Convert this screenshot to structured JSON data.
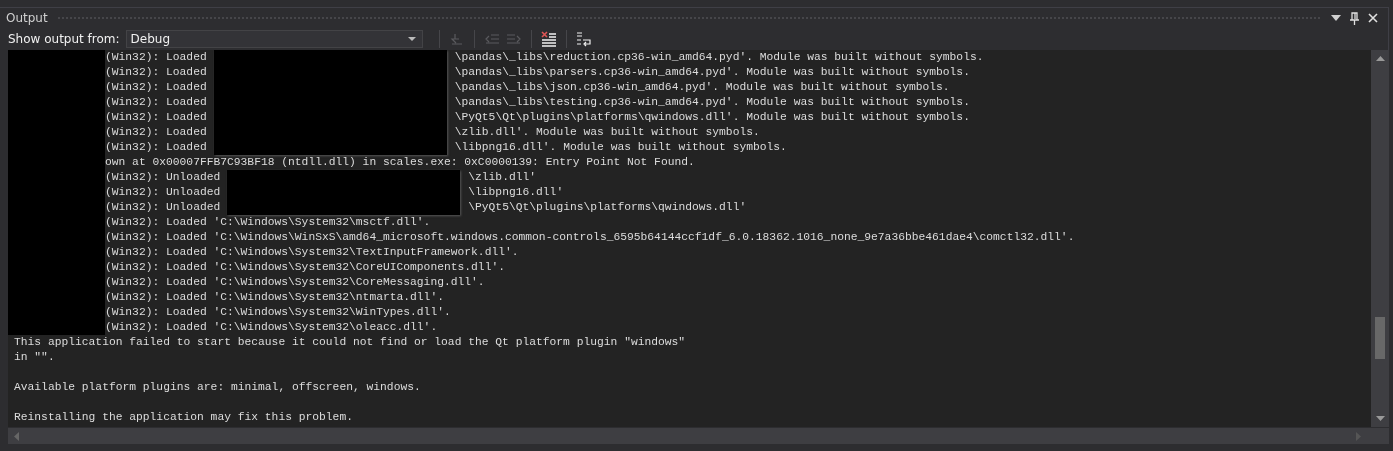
{
  "panel": {
    "title": "Output"
  },
  "toolbar": {
    "label": "Show output from:",
    "source": {
      "value": "Debug"
    },
    "buttons": [
      {
        "kind": "goto",
        "disabled": true
      },
      {
        "kind": "prev",
        "disabled": true
      },
      {
        "kind": "next",
        "disabled": true
      },
      {
        "kind": "clear",
        "disabled": false
      },
      {
        "kind": "wrap",
        "disabled": false
      }
    ]
  },
  "log": {
    "groups": [
      {
        "kind": "redacted",
        "lines": [
          {
            "prefix": "(Win32): Loaded",
            "suffix": "\\pandas\\_libs\\reduction.cp36-win_amd64.pyd'. Module was built without symbols."
          },
          {
            "prefix": "(Win32): Loaded",
            "suffix": "\\pandas\\_libs\\parsers.cp36-win_amd64.pyd'. Module was built without symbols."
          },
          {
            "prefix": "(Win32): Loaded",
            "suffix": "\\pandas\\_libs\\json.cp36-win_amd64.pyd'. Module was built without symbols."
          },
          {
            "prefix": "(Win32): Loaded",
            "suffix": "\\pandas\\_libs\\testing.cp36-win_amd64.pyd'. Module was built without symbols."
          },
          {
            "prefix": "(Win32): Loaded",
            "suffix": "\\PyQt5\\Qt\\plugins\\platforms\\qwindows.dll'. Module was built without symbols."
          },
          {
            "prefix": "(Win32): Loaded",
            "suffix": "\\zlib.dll'. Module was built without symbols."
          },
          {
            "prefix": "(Win32): Loaded",
            "suffix": "\\libpng16.dll'. Module was built without symbols."
          }
        ]
      },
      {
        "kind": "plain",
        "lines": [
          "own at 0x00007FFB7C93BF18 (ntdll.dll) in scales.exe: 0xC0000139: Entry Point Not Found."
        ]
      },
      {
        "kind": "redacted",
        "lines": [
          {
            "prefix": "(Win32): Unloaded",
            "suffix": "\\zlib.dll'"
          },
          {
            "prefix": "(Win32): Unloaded",
            "suffix": "\\libpng16.dll'"
          },
          {
            "prefix": "(Win32): Unloaded",
            "suffix": "\\PyQt5\\Qt\\plugins\\platforms\\qwindows.dll'"
          }
        ]
      },
      {
        "kind": "plain",
        "lines": [
          "(Win32): Loaded 'C:\\Windows\\System32\\msctf.dll'.",
          "(Win32): Loaded 'C:\\Windows\\WinSxS\\amd64_microsoft.windows.common-controls_6595b64144ccf1df_6.0.18362.1016_none_9e7a36bbe461dae4\\comctl32.dll'.",
          "(Win32): Loaded 'C:\\Windows\\System32\\TextInputFramework.dll'.",
          "(Win32): Loaded 'C:\\Windows\\System32\\CoreUIComponents.dll'.",
          "(Win32): Loaded 'C:\\Windows\\System32\\CoreMessaging.dll'.",
          "(Win32): Loaded 'C:\\Windows\\System32\\ntmarta.dll'.",
          "(Win32): Loaded 'C:\\Windows\\System32\\WinTypes.dll'.",
          "(Win32): Loaded 'C:\\Windows\\System32\\oleacc.dll'."
        ]
      }
    ],
    "messages": [
      {
        "lines": [
          "This application failed to start because it could not find or load the Qt platform plugin \"windows\"",
          "in \"\"."
        ]
      },
      {
        "lines": [
          "Available platform plugins are: minimal, offscreen, windows."
        ]
      },
      {
        "lines": [
          "Reinstalling the application may fix this problem."
        ]
      }
    ]
  }
}
